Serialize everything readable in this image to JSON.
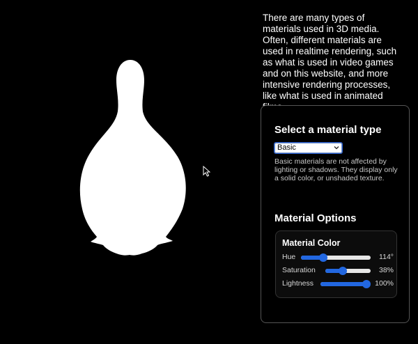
{
  "intro_text": "There are many types of materials used in 3D media. Often, different materials are used in realtime rendering, such as what is used in video games and on this website, and more intensive rendering processes, like what is used in animated films.",
  "material_panel": {
    "title": "Select a material type",
    "select": {
      "selected": "Basic"
    },
    "description": "Basic materials are not affected by lighting or shadows. They display only a solid color, or unshaded texture."
  },
  "options": {
    "title": "Material Options",
    "color_card": {
      "title": "Material Color",
      "sliders": [
        {
          "label": "Hue",
          "value_text": "114°",
          "fraction": 0.317
        },
        {
          "label": "Saturation",
          "value_text": "38%",
          "fraction": 0.38
        },
        {
          "label": "Lightness",
          "value_text": "100%",
          "fraction": 1.0
        }
      ]
    }
  },
  "colors": {
    "background": "#000000",
    "model": "#ffffff",
    "accent": "#2267e0"
  },
  "icons": {
    "cursor": "arrow-cursor-icon",
    "select_chevron": "chevron-down-icon"
  }
}
